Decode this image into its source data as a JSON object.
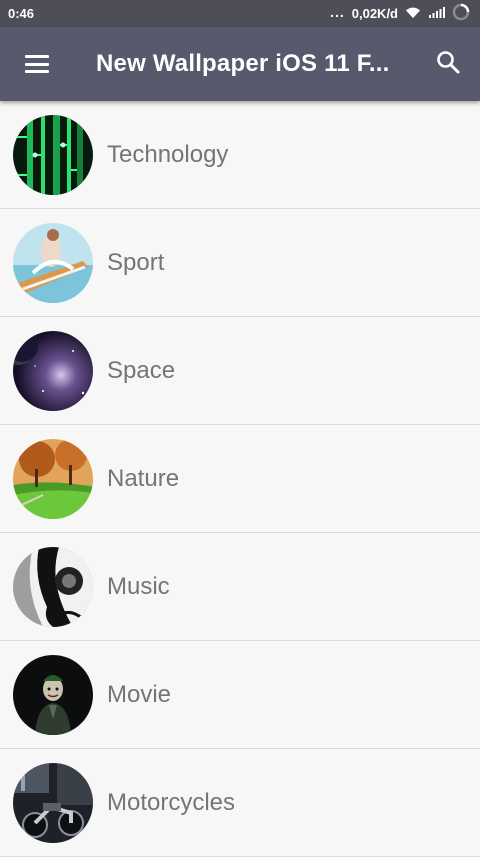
{
  "status_bar": {
    "time": "0:46",
    "dots": "...",
    "network_speed": "0,02K/d",
    "icons": [
      "wifi-icon",
      "signal-icon",
      "loading-icon"
    ]
  },
  "toolbar": {
    "title": "New Wallpaper iOS 11 F...",
    "menu_icon": "menu-icon",
    "search_icon": "search-icon"
  },
  "categories": [
    {
      "label": "Technology",
      "thumb": "technology-thumbnail"
    },
    {
      "label": "Sport",
      "thumb": "sport-thumbnail"
    },
    {
      "label": "Space",
      "thumb": "space-thumbnail"
    },
    {
      "label": "Nature",
      "thumb": "nature-thumbnail"
    },
    {
      "label": "Music",
      "thumb": "music-thumbnail"
    },
    {
      "label": "Movie",
      "thumb": "movie-thumbnail"
    },
    {
      "label": "Motorcycles",
      "thumb": "motorcycles-thumbnail"
    }
  ],
  "colors": {
    "status_bar": "#4e4e58",
    "toolbar": "#565a6c",
    "list_text": "#757575",
    "divider": "#dcdcdc"
  }
}
